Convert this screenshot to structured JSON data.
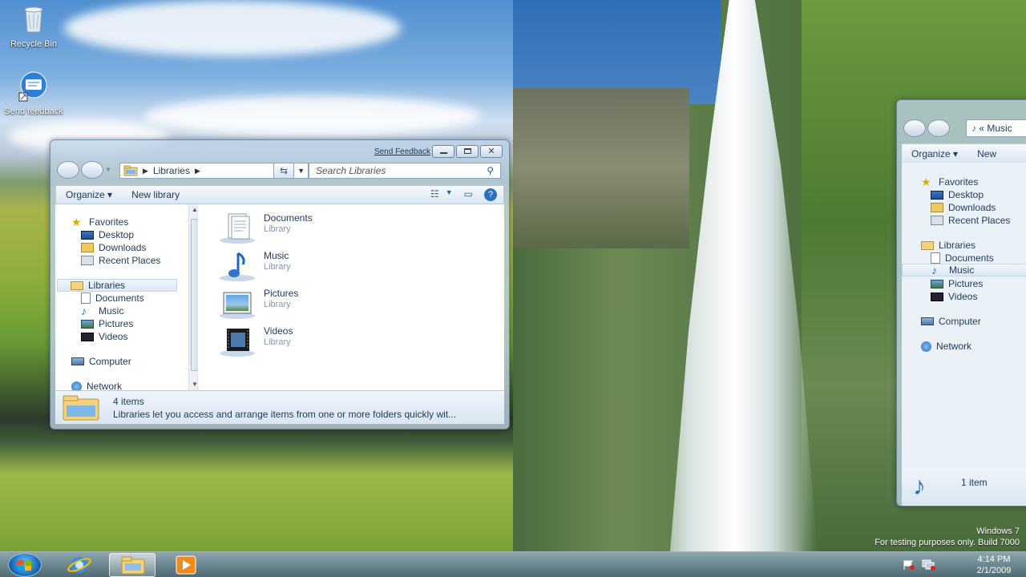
{
  "desktop": {
    "icons": [
      {
        "label": "Recycle Bin",
        "icon": "recycle-bin-icon"
      },
      {
        "label": "Send feedback",
        "icon": "send-feedback-icon"
      }
    ],
    "watermark": {
      "line1": "Windows 7",
      "line2": "For testing purposes only. Build 7000"
    }
  },
  "explorer": {
    "send_feedback": "Send Feedback",
    "address": {
      "location": "Libraries"
    },
    "search": {
      "placeholder": "Search Libraries"
    },
    "toolbar": {
      "organize": "Organize",
      "new_library": "New library"
    },
    "nav": {
      "favorites": "Favorites",
      "favorites_items": [
        "Desktop",
        "Downloads",
        "Recent Places"
      ],
      "libraries": "Libraries",
      "libraries_items": [
        "Documents",
        "Music",
        "Pictures",
        "Videos"
      ],
      "computer": "Computer",
      "network": "Network"
    },
    "libraries": [
      {
        "name": "Documents",
        "type": "Library"
      },
      {
        "name": "Music",
        "type": "Library"
      },
      {
        "name": "Pictures",
        "type": "Library"
      },
      {
        "name": "Videos",
        "type": "Library"
      }
    ],
    "details": {
      "count": "4 items",
      "description": "Libraries let you access and arrange items from one or more folders quickly wit..."
    }
  },
  "music_window": {
    "address": "« Music",
    "toolbar": {
      "organize": "Organize",
      "new": "New"
    },
    "nav": {
      "favorites": "Favorites",
      "favorites_items": [
        "Desktop",
        "Downloads",
        "Recent Places"
      ],
      "libraries": "Libraries",
      "libraries_items": [
        "Documents",
        "Music",
        "Pictures",
        "Videos"
      ],
      "computer": "Computer",
      "network": "Network"
    },
    "details": {
      "count": "1 item"
    }
  },
  "taskbar": {
    "clock": {
      "time": "4:14 PM",
      "date": "2/1/2009"
    }
  },
  "colors": {
    "accent": "#1e395b",
    "selection": "#dde8f4"
  }
}
